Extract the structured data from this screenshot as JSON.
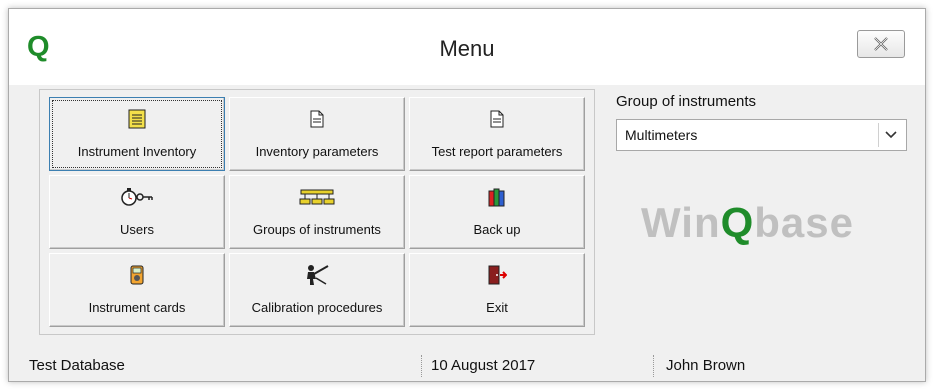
{
  "window": {
    "title": "Menu",
    "logo": "Q"
  },
  "tiles": [
    {
      "label": "Instrument Inventory",
      "icon": "notepad-icon"
    },
    {
      "label": "Inventory parameters",
      "icon": "document-icon"
    },
    {
      "label": "Test report parameters",
      "icon": "document-icon"
    },
    {
      "label": "Users",
      "icon": "stopwatch-key-icon"
    },
    {
      "label": "Groups of instruments",
      "icon": "hierarchy-icon"
    },
    {
      "label": "Back up",
      "icon": "books-icon"
    },
    {
      "label": "Instrument cards",
      "icon": "multimeter-icon"
    },
    {
      "label": "Calibration procedures",
      "icon": "technician-icon"
    },
    {
      "label": "Exit",
      "icon": "exit-door-icon"
    }
  ],
  "group": {
    "label": "Group of instruments",
    "selected": "Multimeters"
  },
  "brand": {
    "prefix": "Win",
    "q": "Q",
    "suffix": "base"
  },
  "status": {
    "database": "Test Database",
    "date": "10 August 2017",
    "user": "John Brown"
  }
}
